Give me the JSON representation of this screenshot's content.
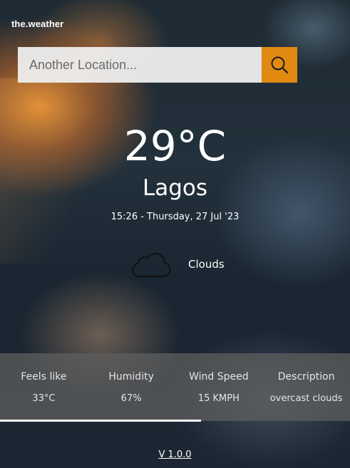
{
  "brand": {
    "logo_text": "the.weather"
  },
  "search": {
    "placeholder": "Another Location...",
    "value": "",
    "icon": "search-icon"
  },
  "weather": {
    "temperature": "29°C",
    "city": "Lagos",
    "datetime": "15:26 - Thursday, 27 Jul '23",
    "condition": "Clouds",
    "condition_icon": "cloud-icon"
  },
  "stats": [
    {
      "label": "Feels like",
      "value": "33°C"
    },
    {
      "label": "Humidity",
      "value": "67%"
    },
    {
      "label": "Wind Speed",
      "value": "15 KMPH"
    },
    {
      "label": "Description",
      "value": "overcast clouds"
    }
  ],
  "footer": {
    "version": "V 1.0.0"
  },
  "colors": {
    "accent": "#e08a12",
    "search_bg": "#eeeeee",
    "stats_bg": "#5f5f5f"
  }
}
